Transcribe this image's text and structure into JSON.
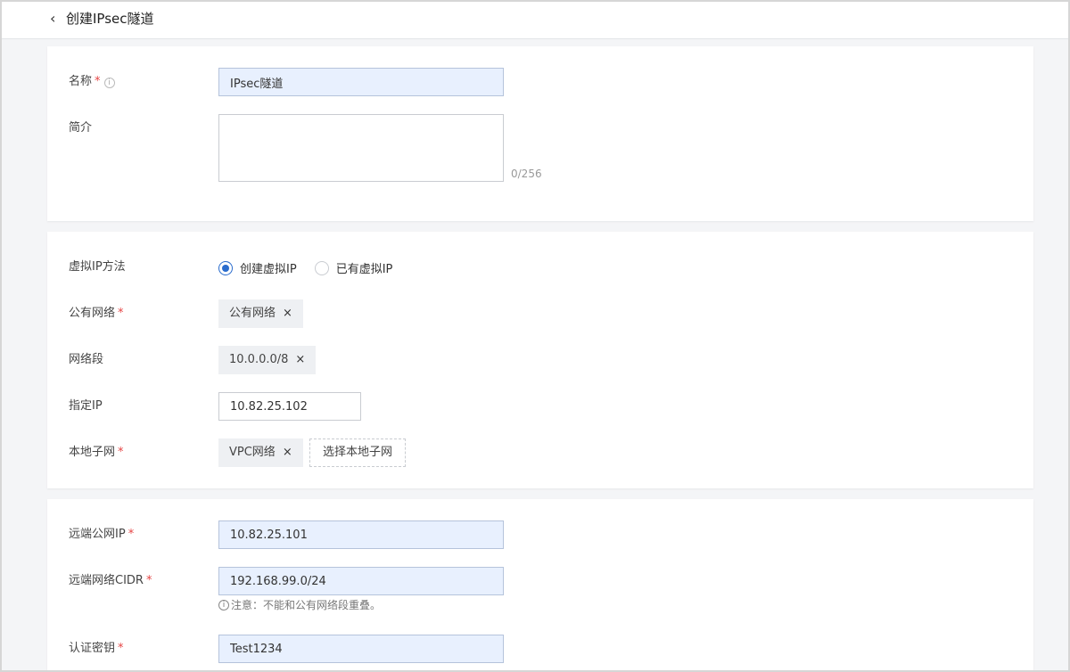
{
  "header": {
    "back_icon": "‹",
    "title": "创建IPsec隧道"
  },
  "basic": {
    "name_label": "名称",
    "required_mark": "*",
    "info_icon": "i",
    "name_value": "IPsec隧道",
    "desc_label": "简介",
    "desc_value": "",
    "desc_counter": "0/256"
  },
  "network": {
    "vip_method_label": "虚拟IP方法",
    "vip_options": [
      "创建虚拟IP",
      "已有虚拟IP"
    ],
    "vip_selected": "创建虚拟IP",
    "public_network_label": "公有网络",
    "public_network_tag": "公有网络",
    "segment_label": "网络段",
    "segment_tag": "10.0.0.0/8",
    "ip_label": "指定IP",
    "ip_value": "10.82.25.102",
    "local_subnet_label": "本地子网",
    "local_subnet_tag": "VPC网络",
    "select_subnet_button": "选择本地子网",
    "remove_icon": "×"
  },
  "remote": {
    "remote_ip_label": "远端公网IP",
    "remote_ip_value": "10.82.25.101",
    "remote_cidr_label": "远端网络CIDR",
    "remote_cidr_value": "192.168.99.0/24",
    "cidr_hint_icon": "i",
    "cidr_hint": "注意：不能和公有网络段重叠。",
    "auth_key_label": "认证密钥",
    "auth_key_value": "Test1234"
  },
  "colors": {
    "accent": "#2a6ccd",
    "required": "#e54545",
    "filled_input_bg": "#e8f0fe"
  }
}
